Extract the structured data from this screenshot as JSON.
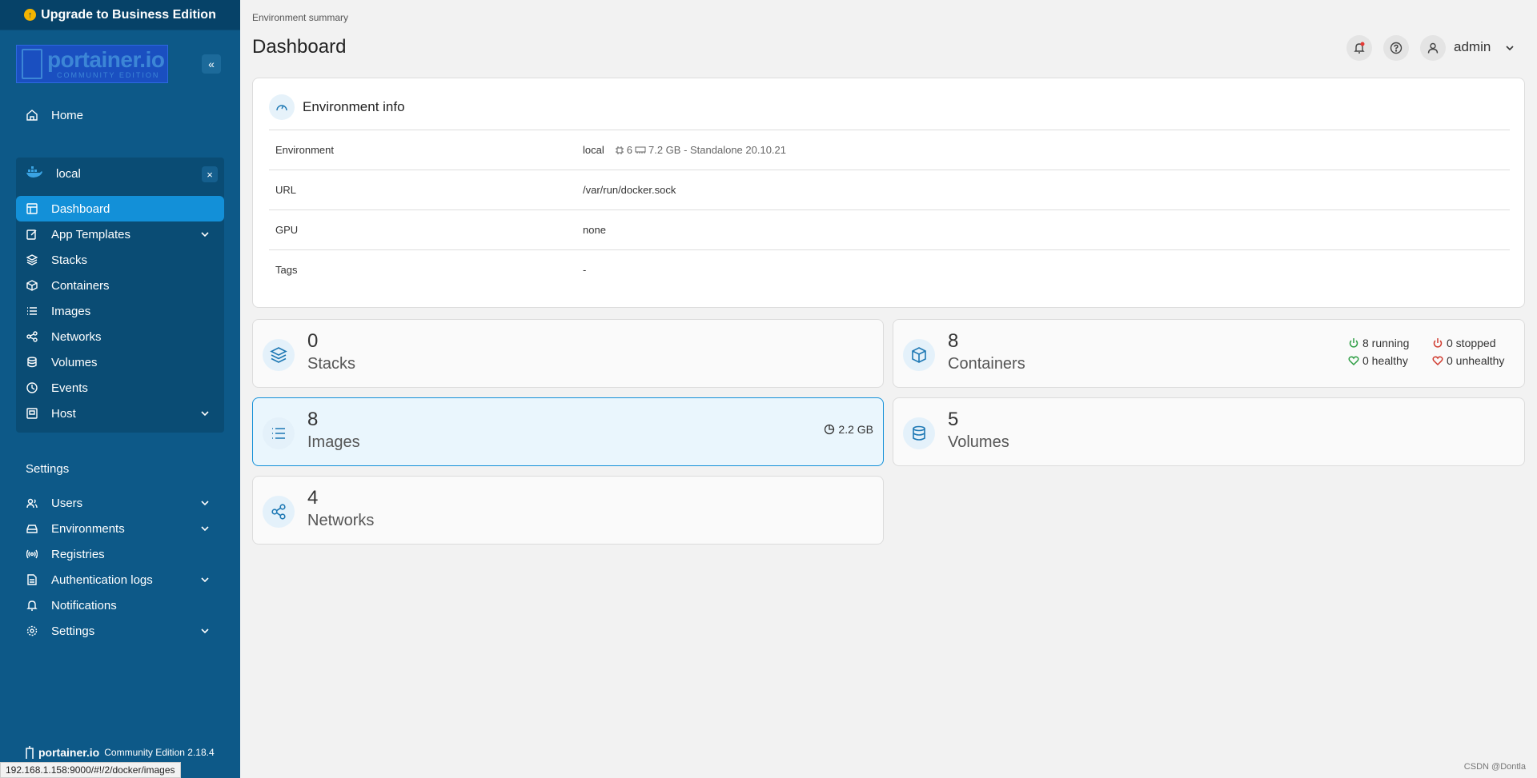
{
  "sidebar": {
    "upgrade_label": "Upgrade to Business Edition",
    "logo_text": "portainer.io",
    "logo_sub": "COMMUNITY EDITION",
    "home_label": "Home",
    "env": {
      "name": "local",
      "items": [
        {
          "label": "Dashboard",
          "icon": "dashboard-icon"
        },
        {
          "label": "App Templates",
          "icon": "edit-icon"
        },
        {
          "label": "Stacks",
          "icon": "layers-icon"
        },
        {
          "label": "Containers",
          "icon": "box-icon"
        },
        {
          "label": "Images",
          "icon": "list-icon"
        },
        {
          "label": "Networks",
          "icon": "share-icon"
        },
        {
          "label": "Volumes",
          "icon": "database-icon"
        },
        {
          "label": "Events",
          "icon": "clock-icon"
        },
        {
          "label": "Host",
          "icon": "server-icon"
        }
      ]
    },
    "settings_title": "Settings",
    "settings_items": [
      {
        "label": "Users",
        "icon": "users-icon"
      },
      {
        "label": "Environments",
        "icon": "hard-drive-icon"
      },
      {
        "label": "Registries",
        "icon": "radio-icon"
      },
      {
        "label": "Authentication logs",
        "icon": "file-text-icon"
      },
      {
        "label": "Notifications",
        "icon": "bell-icon"
      },
      {
        "label": "Settings",
        "icon": "gear-icon"
      }
    ],
    "footer_brand": "portainer.io",
    "footer_version": "Community Edition 2.18.4"
  },
  "status_bar_url": "192.168.1.158:9000/#!/2/docker/images",
  "header": {
    "breadcrumb": "Environment summary",
    "title": "Dashboard",
    "user": "admin"
  },
  "env_info": {
    "title": "Environment info",
    "rows": {
      "environment": {
        "key": "Environment",
        "name": "local",
        "cpu": "6",
        "memory": "7.2 GB - Standalone 20.10.21"
      },
      "url": {
        "key": "URL",
        "value": "/var/run/docker.sock"
      },
      "gpu": {
        "key": "GPU",
        "value": "none"
      },
      "tags": {
        "key": "Tags",
        "value": "-"
      }
    }
  },
  "stats": {
    "stacks": {
      "count": "0",
      "label": "Stacks"
    },
    "containers": {
      "count": "8",
      "label": "Containers",
      "running": "8 running",
      "stopped": "0 stopped",
      "healthy": "0 healthy",
      "unhealthy": "0 unhealthy"
    },
    "images": {
      "count": "8",
      "label": "Images",
      "size": "2.2 GB"
    },
    "volumes": {
      "count": "5",
      "label": "Volumes"
    },
    "networks": {
      "count": "4",
      "label": "Networks"
    }
  },
  "watermark": "CSDN @Dontla",
  "colors": {
    "sidebar": "#0d5988",
    "active": "#1390d8",
    "running": "#2e9e44",
    "stopped": "#d03b2f"
  }
}
